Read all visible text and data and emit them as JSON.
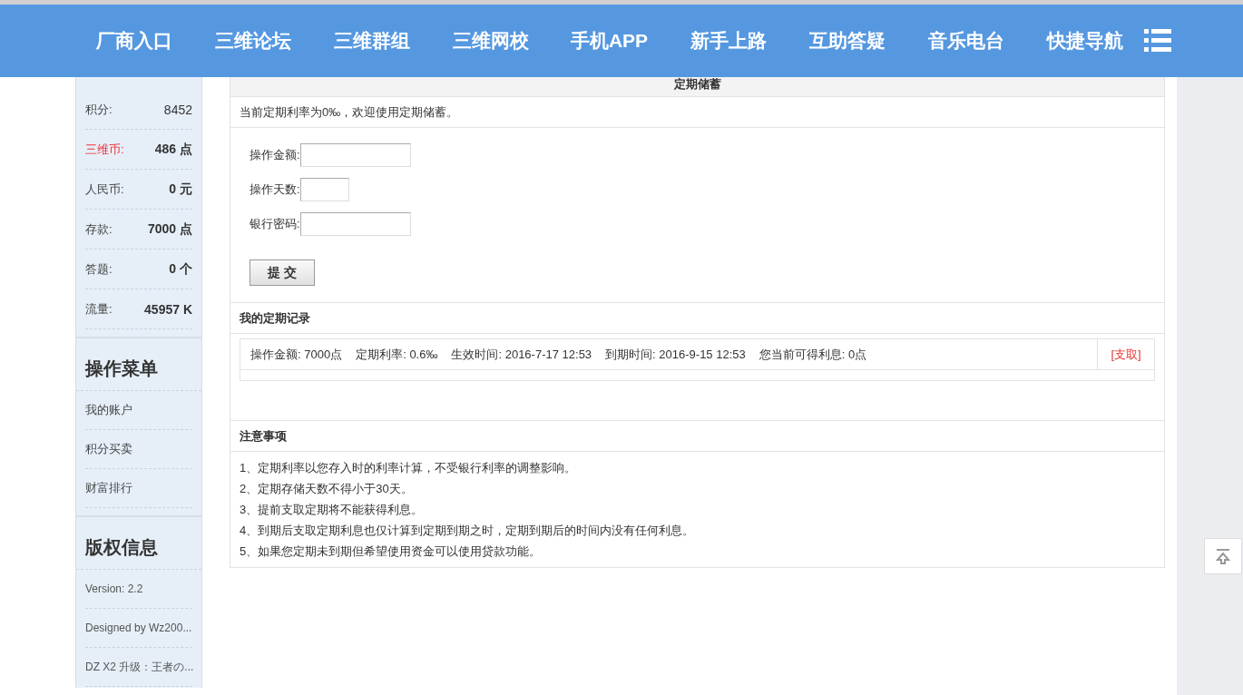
{
  "nav": {
    "items": [
      "厂商入口",
      "三维论坛",
      "三维群组",
      "三维网校",
      "手机APP",
      "新手上路",
      "互助答疑",
      "音乐电台",
      "快捷导航"
    ]
  },
  "sidebar": {
    "stats": [
      {
        "label": "积分:",
        "value": "8452",
        "highlight": false,
        "bold": false
      },
      {
        "label": "三维币:",
        "value": "486 点",
        "highlight": true,
        "bold": true
      },
      {
        "label": "人民币:",
        "value": "0 元",
        "highlight": false,
        "bold": true
      },
      {
        "label": "存款:",
        "value": "7000 点",
        "highlight": false,
        "bold": true
      },
      {
        "label": "答题:",
        "value": "0 个",
        "highlight": false,
        "bold": true
      },
      {
        "label": "流量:",
        "value": "45957 K",
        "highlight": false,
        "bold": true
      }
    ],
    "sections": [
      {
        "title": "操作菜单",
        "kind": "menu",
        "items": [
          "我的账户",
          "积分买卖",
          "财富排行"
        ]
      },
      {
        "title": "版权信息",
        "kind": "info",
        "items": [
          "Version: 2.2",
          "Designed by Wz200...",
          "DZ X2 升级：王者の..."
        ]
      }
    ]
  },
  "deposit": {
    "title": "定期储蓄",
    "notice": "当前定期利率为0‰，欢迎使用定期储蓄。",
    "fields": [
      {
        "label": "操作金额:",
        "kind": "wide"
      },
      {
        "label": "操作天数:",
        "kind": "narrow"
      },
      {
        "label": "银行密码:",
        "kind": "wide"
      }
    ],
    "submit": "提 交"
  },
  "records": {
    "title": "我的定期记录",
    "rows": [
      {
        "parts": [
          "操作金额: 7000点",
          "定期利率: 0.6‰",
          "生效时间: 2016-7-17 12:53",
          "到期时间: 2016-9-15 12:53",
          "您当前可得利息: 0点"
        ],
        "action": "[支取]"
      }
    ]
  },
  "notes": {
    "title": "注意事项",
    "items": [
      "1、定期利率以您存入时的利率计算，不受银行利率的调整影响。",
      "2、定期存储天数不得小于30天。",
      "3、提前支取定期将不能获得利息。",
      "4、到期后支取定期利息也仅计算到定期到期之时，定期到期后的时间内没有任何利息。",
      "5、如果您定期未到期但希望使用资金可以使用贷款功能。"
    ]
  }
}
